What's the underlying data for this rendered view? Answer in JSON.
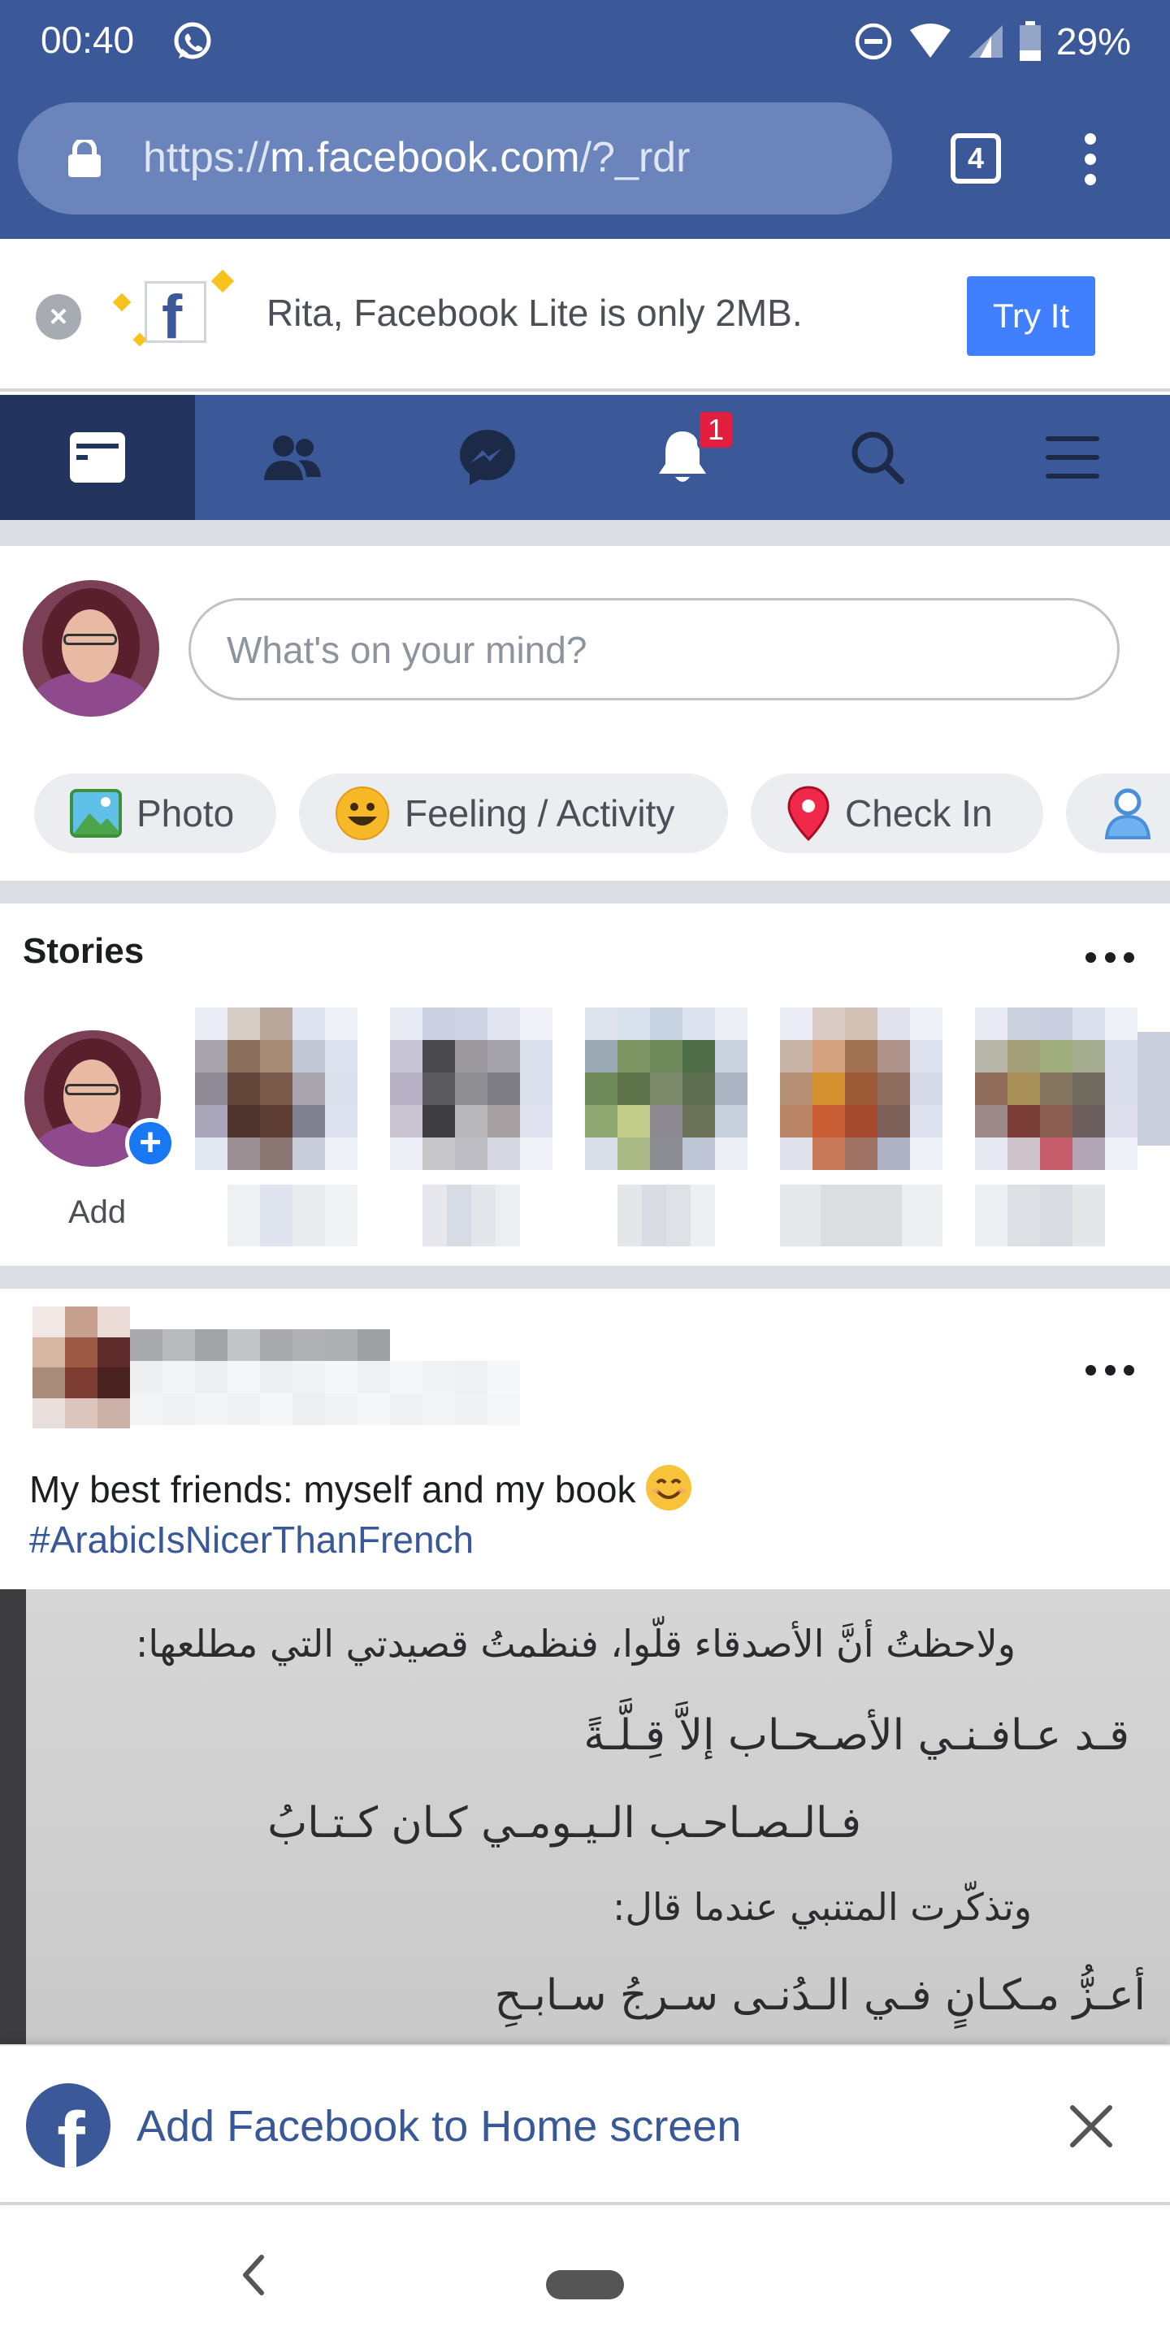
{
  "status_bar": {
    "time": "00:40",
    "battery": "29%"
  },
  "browser": {
    "url_scheme": "https://",
    "url_host": "m.facebook.com",
    "url_path": "/?_rdr",
    "tab_count": "4"
  },
  "lite_banner": {
    "message": "Rita, Facebook Lite is only 2MB.",
    "button_label": "Try It",
    "logo_letter": "f"
  },
  "nav": {
    "items": [
      {
        "icon": "news-feed-icon",
        "active": true
      },
      {
        "icon": "friends-icon"
      },
      {
        "icon": "messenger-icon"
      },
      {
        "icon": "notifications-icon",
        "badge": "1"
      },
      {
        "icon": "search-icon"
      },
      {
        "icon": "menu-icon"
      }
    ]
  },
  "composer": {
    "placeholder": "What's on your mind?",
    "chips": [
      {
        "label": "Photo",
        "icon": "photo-icon"
      },
      {
        "label": "Feeling / Activity",
        "icon": "smiley-icon"
      },
      {
        "label": "Check In",
        "icon": "location-pin-icon"
      },
      {
        "label": "",
        "icon": "tag-friends-icon"
      }
    ]
  },
  "stories": {
    "title": "Stories",
    "add_label": "Add",
    "add_symbol": "+"
  },
  "post": {
    "text": "My best friends: myself and my book",
    "hashtag": "#ArabicIsNicerThanFrench",
    "image_lines": [
      "ولاحظتُ أنَّ الأصدقاء قلّوا، فنظمتُ قصيدتي التي مطلعها:",
      "قـد عـافـنـي الأصـحـاب إلاَّ قِـلَّـةً",
      "فـالـصـاحـب الـيـومـي كـان كـتـابُ",
      "وتذكّرت المتنبي عندما قال:",
      "أعـزُّ مـكـانٍ فـي الـدُنـى سـرجُ سـابـحِ"
    ]
  },
  "a2hs": {
    "label": "Add Facebook to Home screen",
    "logo_letter": "f"
  },
  "colors": {
    "facebook_blue": "#3b5998",
    "nav_active": "#23355e",
    "try_it_blue": "#4080ff",
    "badge_red": "#e41e3f",
    "link_blue": "#385898"
  }
}
